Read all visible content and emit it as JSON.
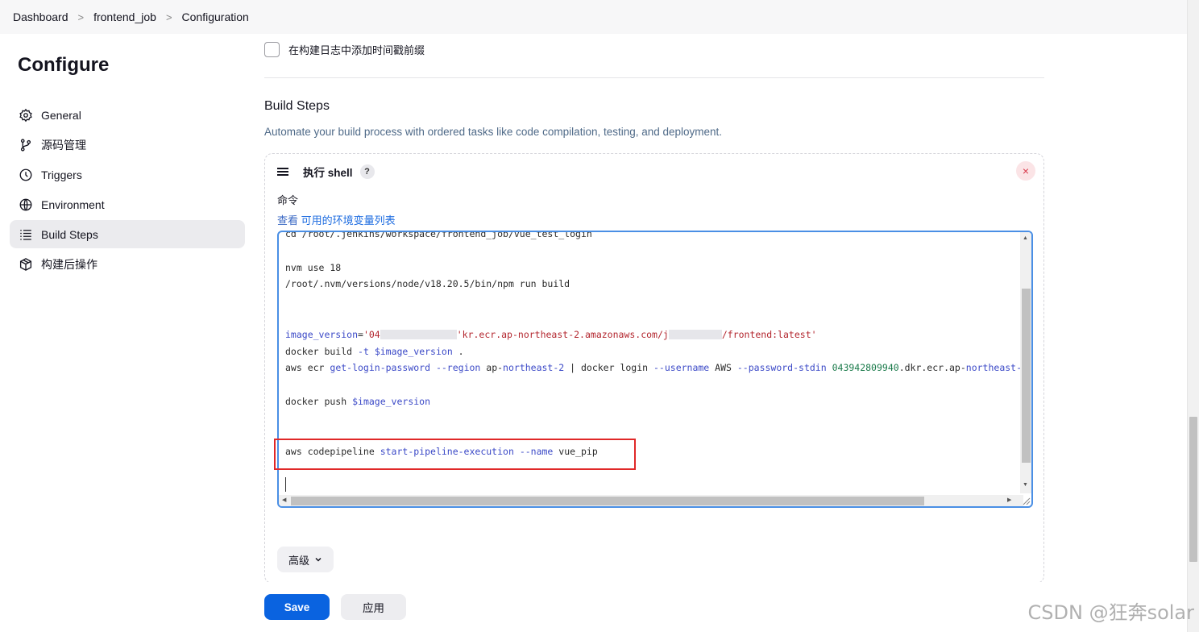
{
  "breadcrumb": {
    "items": [
      "Dashboard",
      "frontend_job",
      "Configuration"
    ],
    "separator": ">"
  },
  "sidebar": {
    "title": "Configure",
    "items": [
      {
        "label": "General",
        "icon": "gear-icon"
      },
      {
        "label": "源码管理",
        "icon": "branch-icon"
      },
      {
        "label": "Triggers",
        "icon": "clock-icon"
      },
      {
        "label": "Environment",
        "icon": "globe-icon"
      },
      {
        "label": "Build Steps",
        "icon": "list-icon",
        "active": true
      },
      {
        "label": "构建后操作",
        "icon": "package-icon"
      }
    ]
  },
  "main": {
    "timestamp_checkbox_label": "在构建日志中添加时间戳前缀",
    "section_title": "Build Steps",
    "section_desc": "Automate your build process with ordered tasks like code compilation, testing, and deployment.",
    "step": {
      "title": "执行 shell",
      "help": "?",
      "close": "×",
      "field_label": "命令",
      "env_prefix": "查看 ",
      "env_link": "可用的环境变量列表",
      "code": {
        "line1": "cd /root/.jenkins/workspace/frontend_job/vue_test_login",
        "line3": "nvm use 18",
        "line4": "/root/.nvm/versions/node/v18.20.5/bin/npm run build",
        "line7_var": "image_version",
        "line7_eq": "=",
        "line7_s1": "'04",
        "line7_s2": "'kr.ecr.ap-northeast-2.amazonaws.com/j",
        "line7_s3": "/frontend:latest'",
        "line8_a": "docker build ",
        "line8_b": "-t",
        "line8_c": " ",
        "line8_d": "$image_version",
        "line8_e": " .",
        "line9_a": "aws ecr ",
        "line9_b": "get-login-password",
        "line9_c": " ",
        "line9_d": "--region",
        "line9_e": " ap-",
        "line9_f": "northeast-2",
        "line9_g": " | docker login ",
        "line9_h": "--username",
        "line9_i": " AWS ",
        "line9_j": "--password-stdin",
        "line9_k": " ",
        "line9_l": "043942809940",
        "line9_m": ".dkr.ecr.ap-",
        "line9_n": "northeast-",
        "line11_a": "docker push ",
        "line11_b": "$image_version",
        "line14_a": "aws codepipeline ",
        "line14_b": "start-pipeline-execution",
        "line14_c": " ",
        "line14_d": "--name",
        "line14_e": " vue_pip"
      }
    },
    "advanced_label": "高级"
  },
  "footer": {
    "save_label": "Save",
    "apply_label": "应用"
  },
  "watermark": "CSDN @狂奔solar",
  "colors": {
    "primary": "#0a63e0",
    "highlight": "#e02828",
    "link": "#1d6ce0",
    "close": "#d8384a"
  }
}
